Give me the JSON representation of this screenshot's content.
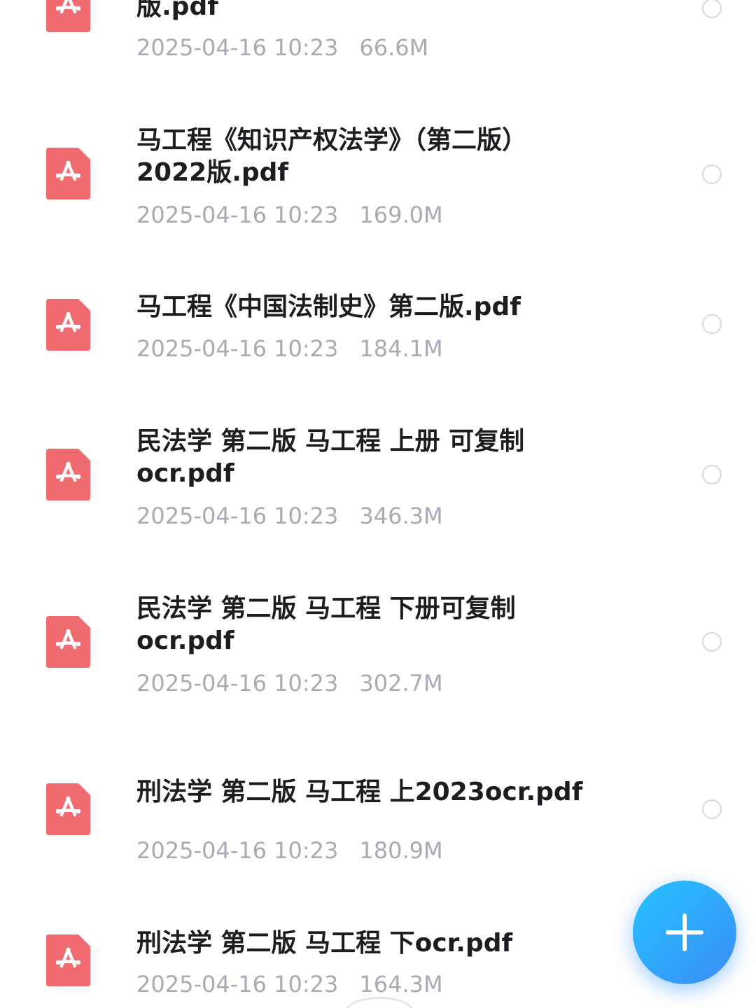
{
  "files": [
    {
      "name": "版.pdf",
      "date": "2025-04-16 10:23",
      "size": "66.6M"
    },
    {
      "name": "马工程《知识产权法学》（第二版）\n2022版.pdf",
      "date": "2025-04-16 10:23",
      "size": "169.0M"
    },
    {
      "name": "马工程《中国法制史》第二版.pdf",
      "date": "2025-04-16 10:23",
      "size": "184.1M"
    },
    {
      "name": "民法学 第二版 马工程 上册 可复制\nocr.pdf",
      "date": "2025-04-16 10:23",
      "size": "346.3M"
    },
    {
      "name": "民法学 第二版 马工程 下册可复制\nocr.pdf",
      "date": "2025-04-16 10:23",
      "size": "302.7M"
    },
    {
      "name": "刑法学 第二版 马工程 上2023ocr.pdf",
      "date": "2025-04-16 10:23",
      "size": "180.9M"
    },
    {
      "name": "刑法学 第二版 马工程 下ocr.pdf",
      "date": "2025-04-16 10:23",
      "size": "164.3M"
    }
  ],
  "icons": {
    "file": "pdf-file-icon",
    "select": "radio-circle-icon",
    "fab": "plus-icon"
  },
  "colors": {
    "pdf_icon": "#f06b6f",
    "fab": "#2ea8f8",
    "title": "#1c1d22",
    "meta": "#a7abb5"
  }
}
